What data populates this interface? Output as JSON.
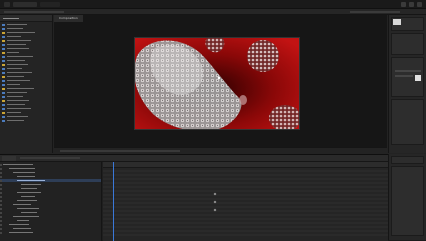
{
  "viewer": {
    "tab_label": "Composition",
    "composition_colors": {
      "background": "#7a0505",
      "cell": "#d8d8d8"
    }
  },
  "icons": [
    "close-icon",
    "minimize-icon",
    "maximize-icon",
    "play-icon",
    "folder-icon",
    "layer-icon"
  ],
  "colors": {
    "playhead": "#3a78d8",
    "selection": "#2e3e57",
    "label_blue": "#4b7bbd",
    "label_yellow": "#c9a435"
  }
}
